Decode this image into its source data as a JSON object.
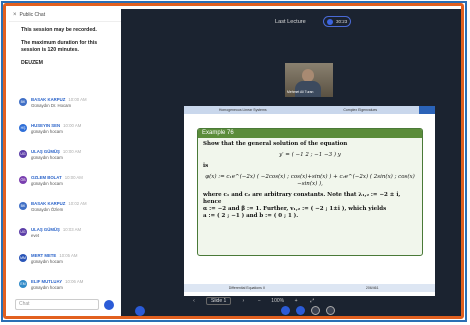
{
  "chat": {
    "title": "Public Chat",
    "notice": [
      "This session may be recorded.",
      "The maximum duration for this session is 120 minutes."
    ],
    "notice_user": "DEUZEM",
    "messages": [
      {
        "initials": "BK",
        "name": "BASAK KARPUZ",
        "time": "10:00 AM",
        "text": "Günaydın Dr. Hocam",
        "color": "#3f6fc6"
      },
      {
        "initials": "HŞ",
        "name": "HUSEYIN SEN",
        "time": "10:00 AM",
        "text": "günaydın hocam",
        "color": "#2f6fd8"
      },
      {
        "initials": "UG",
        "name": "ULAŞ GÜMÜŞ",
        "time": "10:00 AM",
        "text": "günaydın hocam",
        "color": "#5c3ea8"
      },
      {
        "initials": "ÖB",
        "name": "OZLEM BOLAT",
        "time": "10:00 AM",
        "text": "günaydın hocam",
        "color": "#7a3fb0"
      },
      {
        "initials": "BK",
        "name": "BASAK KARPUZ",
        "time": "10:02 AM",
        "text": "Günaydın Özlem",
        "color": "#3f6fc6"
      },
      {
        "initials": "UG",
        "name": "ULAŞ GÜMÜŞ",
        "time": "10:03 AM",
        "text": "evet",
        "color": "#5c3ea8"
      },
      {
        "initials": "MM",
        "name": "MERT METE",
        "time": "10:05 AM",
        "text": "günaydın hocam",
        "color": "#2a55b8"
      },
      {
        "initials": "EM",
        "name": "ELIF MUTLUAY",
        "time": "10:06 AM",
        "text": "günaydın hocam",
        "color": "#2f8ac8"
      }
    ],
    "input_placeholder": "Chat"
  },
  "header": {
    "title": "Last Lecture",
    "rec_time": "30:23"
  },
  "video": {
    "caption": "Mehmet Ali Turan"
  },
  "slide": {
    "top_left": "Homogeneous Linear Systems",
    "top_right": "Complex Eigenvalues",
    "example_title": "Example 76",
    "lines": [
      "Show that the general solution of the equation",
      "y′ = ( −1  2 ; −1  −3 ) y",
      "is",
      "φ(x) := c₁e^(−2x) ( −2cos(x) ; cos(x)+sin(x) ) + c₂e^(−2x) ( 2sin(x) ; cos(x)−sin(x) ),",
      "where c₁ and c₂ are arbitrary constants. Note that λ₁,₂ := −2 ± i, hence",
      "α := −2 and β := 1. Further, v₁,₂ := ( −2 ; 1±i ), which yields",
      "a := ( 2 ; −1 ) and b := ( 0 ; 1 )."
    ],
    "footer_left": "Differential Equations II",
    "footer_right": "206/461"
  },
  "pager": {
    "slide_label": "Slide 1",
    "zoom": "100%"
  }
}
